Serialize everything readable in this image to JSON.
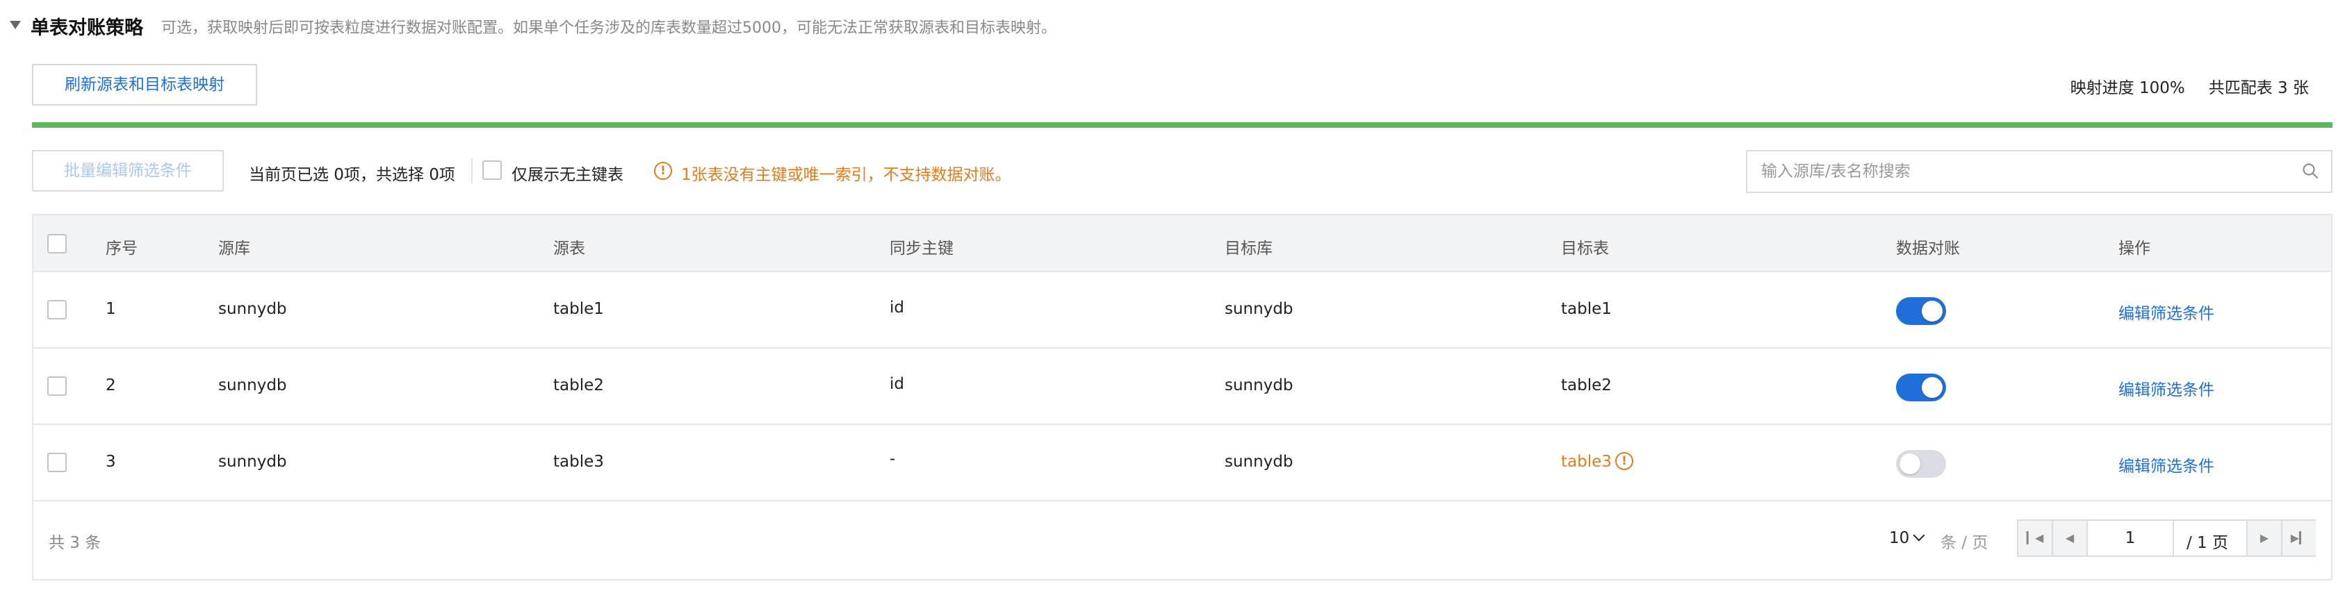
{
  "header": {
    "title": "单表对账策略",
    "description": "可选，获取映射后即可按表粒度进行数据对账配置。如果单个任务涉及的库表数量超过5000，可能无法正常获取源表和目标表映射。"
  },
  "mapping": {
    "refresh_label": "刷新源表和目标表映射",
    "progress_text": "映射进度 100%",
    "matched_text": "共匹配表 3 张",
    "progress_percent": 100,
    "progress_color": "#5cb85c"
  },
  "toolbar": {
    "batch_edit_label": "批量编辑筛选条件",
    "selection_text": "当前页已选 0项，共选择 0项",
    "only_no_pk_label": "仅展示无主键表",
    "warning_text": "1张表没有主键或唯一索引，不支持数据对账。",
    "search_placeholder": "输入源库/表名称搜索"
  },
  "table": {
    "columns": [
      "序号",
      "源库",
      "源表",
      "同步主键",
      "目标库",
      "目标表",
      "数据对账",
      "操作"
    ],
    "rows": [
      {
        "no": "1",
        "src_db": "sunnydb",
        "src_table": "table1",
        "pk": "id",
        "dst_db": "sunnydb",
        "dst_table": "table1",
        "reconcile": true,
        "action": "编辑筛选条件"
      },
      {
        "no": "2",
        "src_db": "sunnydb",
        "src_table": "table2",
        "pk": "id",
        "dst_db": "sunnydb",
        "dst_table": "table2",
        "reconcile": true,
        "action": "编辑筛选条件"
      },
      {
        "no": "3",
        "src_db": "sunnydb",
        "src_table": "table3",
        "pk": "-",
        "dst_db": "sunnydb",
        "dst_table": "table3",
        "reconcile": false,
        "action": "编辑筛选条件"
      }
    ]
  },
  "footer": {
    "total_text": "共 3 条",
    "page_size": "10",
    "page_size_unit": "条 / 页",
    "current_page": "1",
    "total_pages_text": "/ 1 页"
  },
  "colors": {
    "accent": "#1e6fd9",
    "warning": "#e27d1e",
    "toggle_off": "#d9dde3"
  }
}
